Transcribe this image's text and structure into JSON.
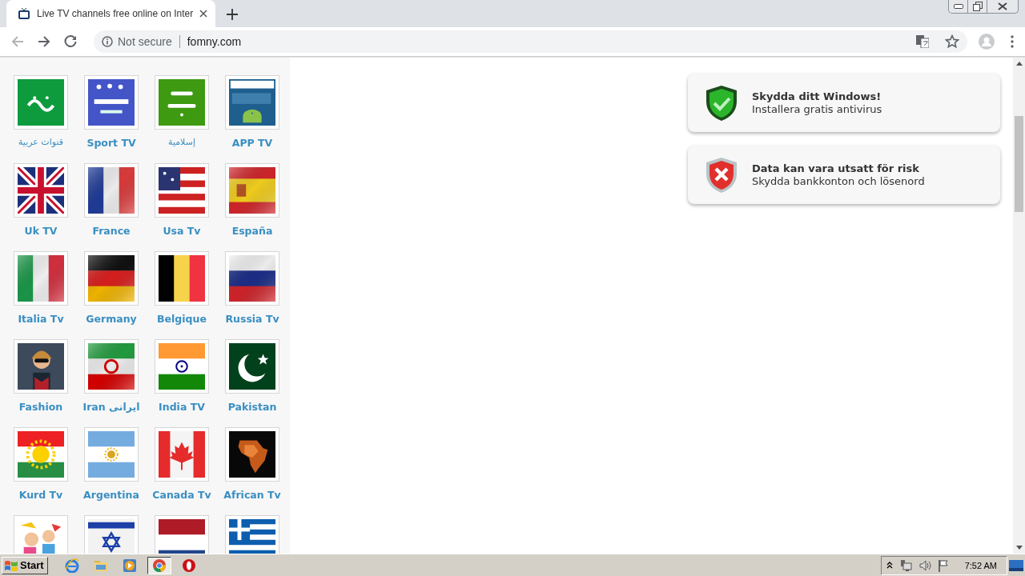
{
  "browser": {
    "tab": {
      "title": "Live TV channels free online on Inter",
      "selected": true
    },
    "back": {
      "disabled": true
    },
    "security": "Not secure",
    "url": "fomny.com"
  },
  "channels": [
    {
      "kind": "channel",
      "label": "قنوات عربية"
    },
    {
      "kind": "channel",
      "label": "Sport TV"
    },
    {
      "kind": "channel",
      "label": "إسلامية"
    },
    {
      "kind": "channel",
      "label": "APP TV"
    },
    {
      "kind": "channel",
      "label": "Uk TV"
    },
    {
      "kind": "channel",
      "label": "France"
    },
    {
      "kind": "channel",
      "label": "Usa Tv"
    },
    {
      "kind": "channel",
      "label": "España"
    },
    {
      "kind": "channel",
      "label": "Italia Tv"
    },
    {
      "kind": "channel",
      "label": "Germany"
    },
    {
      "kind": "channel",
      "label": "Belgique"
    },
    {
      "kind": "channel",
      "label": "Russia Tv"
    },
    {
      "kind": "channel",
      "label": "Fashion"
    },
    {
      "kind": "channel",
      "label": "Iran ایرانی"
    },
    {
      "kind": "channel",
      "label": "India TV"
    },
    {
      "kind": "channel",
      "label": "Pakistan"
    },
    {
      "kind": "channel",
      "label": "Kurd Tv"
    },
    {
      "kind": "channel",
      "label": "Argentina"
    },
    {
      "kind": "channel",
      "label": "Canada Tv"
    },
    {
      "kind": "channel",
      "label": "African Tv"
    },
    {
      "kind": "picture"
    },
    {
      "kind": "picture"
    },
    {
      "kind": "picture"
    },
    {
      "kind": "picture"
    }
  ],
  "notices": [
    {
      "kind": "ok",
      "title": "Skydda ditt Windows!",
      "text": "Installera gratis antivirus"
    },
    {
      "kind": "risk",
      "title": "Data kan vara utsatt för risk",
      "text": "Skydda bankkonton och lösenord"
    }
  ],
  "taskbar": {
    "start": "Start",
    "apps": [
      {
        "kind": "ie",
        "selected": false
      },
      {
        "kind": "explorer",
        "selected": false
      },
      {
        "kind": "media",
        "selected": false
      },
      {
        "kind": "chrome",
        "selected": true
      },
      {
        "kind": "opera",
        "selected": false
      }
    ],
    "clock": "7:52 AM"
  }
}
